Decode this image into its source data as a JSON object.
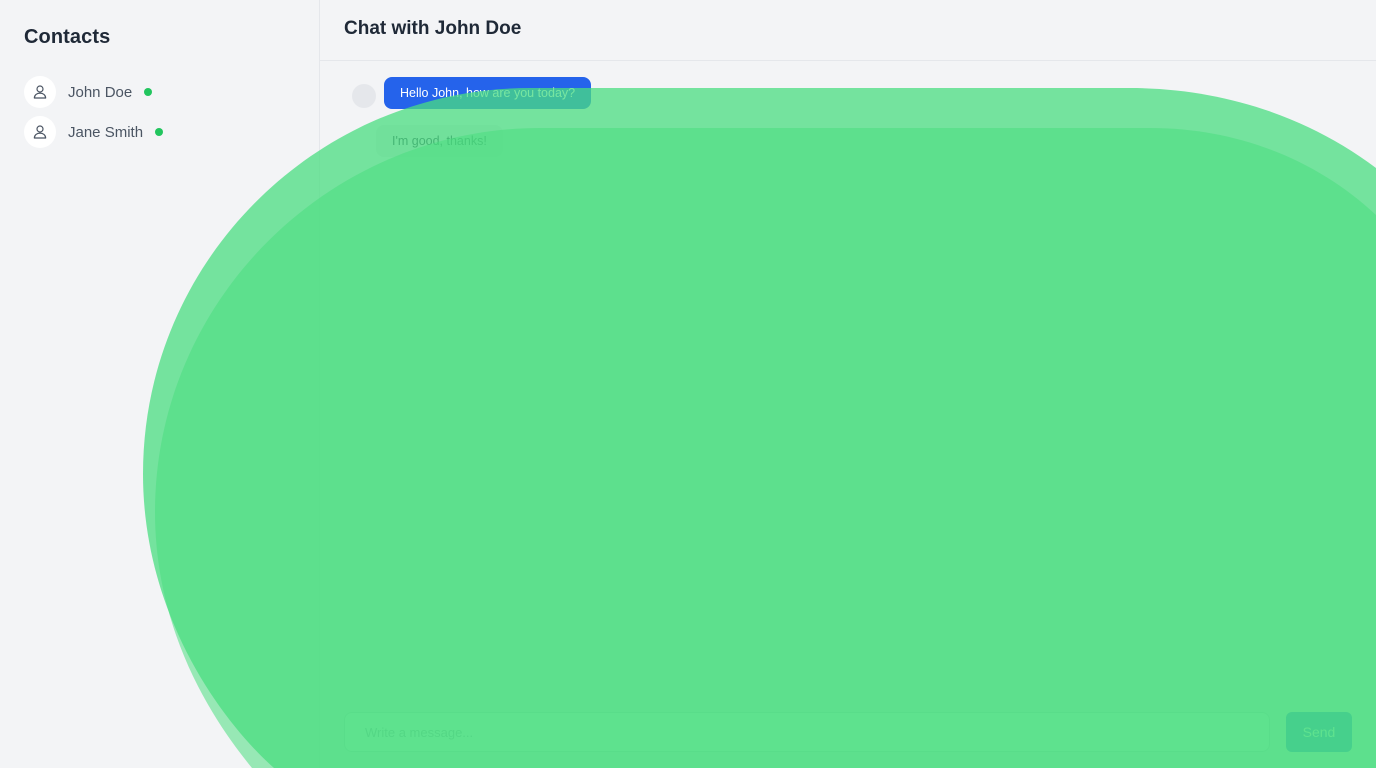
{
  "sidebar": {
    "title": "Contacts",
    "contacts": [
      {
        "name": "John Doe",
        "status": "online",
        "status_color": "#22c55e",
        "icon": "user-icon"
      },
      {
        "name": "Jane Smith",
        "status": "online",
        "status_color": "#22c55e",
        "icon": "user-icon"
      }
    ]
  },
  "chat": {
    "title": "Chat with John Doe",
    "messages": [
      {
        "direction": "outgoing",
        "text": "Hello John, how are you today?"
      },
      {
        "direction": "incoming",
        "text": "I'm good, thanks!"
      }
    ]
  },
  "composer": {
    "placeholder": "Write a message...",
    "send_label": "Send"
  },
  "colors": {
    "accent": "#2563eb",
    "online": "#22c55e",
    "overlay_green": "#4ade80"
  }
}
